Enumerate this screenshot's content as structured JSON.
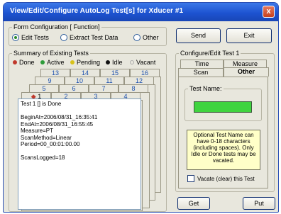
{
  "window": {
    "title": "View/Edit/Configure AutoLog Test[s] for Xducer #1",
    "close_label": "x"
  },
  "form_config": {
    "legend": "Form Configuration  [ Function]",
    "options": [
      "Edit Tests",
      "Extract Test Data",
      "Other"
    ],
    "selected": "Edit Tests"
  },
  "buttons": {
    "send": "Send",
    "exit": "Exit",
    "get": "Get",
    "put": "Put"
  },
  "summary": {
    "legend": "Summary of Existing Tests",
    "statuses": [
      {
        "label": "Done",
        "color": "#c0392b"
      },
      {
        "label": "Active",
        "color": "#2e9c3a"
      },
      {
        "label": "Pending",
        "color": "#d8c21a"
      },
      {
        "label": "Idle",
        "color": "#111111"
      },
      {
        "label": "Vacant",
        "color": "#e8e7dd"
      }
    ],
    "tab_rows": [
      [
        "13",
        "14",
        "15",
        "16"
      ],
      [
        "9",
        "10",
        "11",
        "12"
      ],
      [
        "5",
        "6",
        "7",
        "8"
      ],
      [
        "1",
        "2",
        "3",
        "4"
      ]
    ],
    "active_tab_marker": "◆",
    "details": [
      "Test 1 [] is Done",
      "",
      "BeginAt=2006/08/31_16:35:41",
      "EndAt=2006/08/31_16:55:45",
      "Measure=PT",
      "ScanMethod=Linear",
      "Period=00_00:01:00.00",
      "",
      "ScansLogged=18"
    ]
  },
  "configure": {
    "legend": "Configure/Edit Test 1",
    "tabs": [
      "Time",
      "Measure",
      "Scan",
      "Other"
    ],
    "active_tab": "Other",
    "test_name_label": "Test Name:",
    "test_name_value": "",
    "note": "Optional Test Name can have 0-18 characters (including spaces). Only Idle or Done tests may be vacated.",
    "vacate_label": "Vacate (clear) this Test",
    "accent": "#3fd43f",
    "note_bg": "#ffffc8"
  }
}
